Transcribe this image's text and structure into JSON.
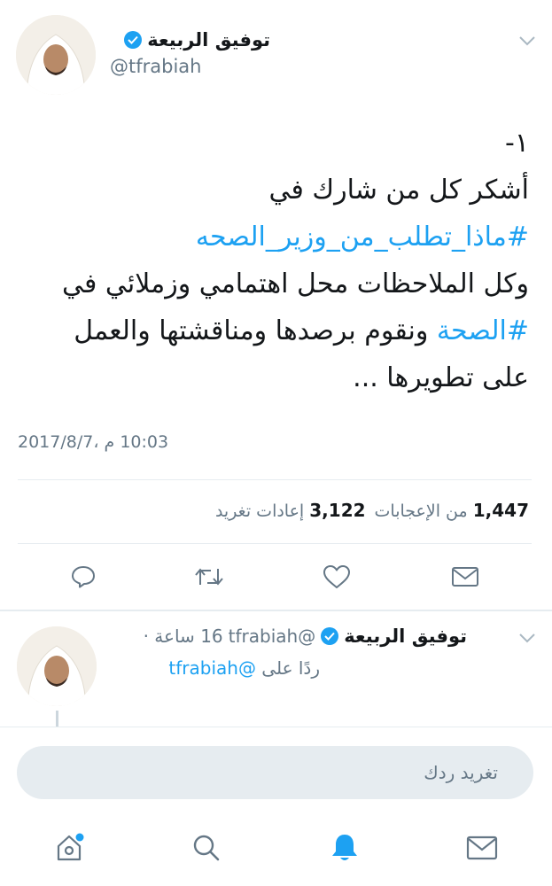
{
  "tweet": {
    "display_name": "توفيق الربيعة",
    "handle": "@tfrabiah",
    "text_lines": [
      "١-",
      "أشكر كل من شارك في",
      "#ماذا_تطلب_من_وزير_الصحه",
      "وكل الملاحظات محل اهتمامي وزملائي في",
      {
        "hashtag": "#الصحة",
        "rest": " ونقوم برصدها ومناقشتها والعمل"
      },
      "على تطويرها ..."
    ],
    "timestamp": "10:03 م ،2017/8/7",
    "likes_count": "1,447",
    "likes_label": "من الإعجابات",
    "retweets_count": "3,122",
    "retweets_label": "إعادات تغريد"
  },
  "actions": [
    {
      "icon": "reply-icon"
    },
    {
      "icon": "retweet-icon"
    },
    {
      "icon": "like-icon"
    },
    {
      "icon": "share-icon"
    }
  ],
  "reply": {
    "display_name": "توفيق الربيعة",
    "handle": "@tfrabiah",
    "time": "16 ساعة ·",
    "reply_to_prefix": "ردًا على",
    "reply_to_handle": "@tfrabiah"
  },
  "compose": {
    "placeholder": "تغريد ردك"
  },
  "bottom_nav": [
    {
      "icon": "home-icon",
      "has_dot": true
    },
    {
      "icon": "search-icon"
    },
    {
      "icon": "notifications-icon",
      "active": true
    },
    {
      "icon": "messages-icon"
    }
  ],
  "colors": {
    "accent": "#1da1f2",
    "text": "#14171a",
    "muted": "#657786",
    "divider": "#e6ecf0"
  }
}
